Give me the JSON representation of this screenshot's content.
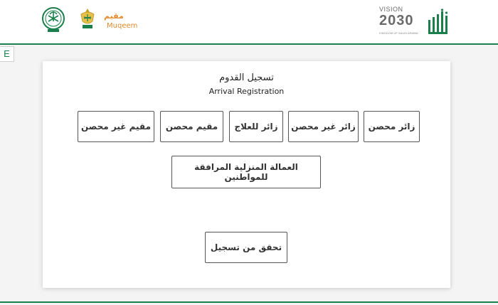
{
  "header": {
    "muqeem_ar": "مقيم",
    "muqeem_en": "Muqeem",
    "vision_word": "VISION",
    "vision_year": "2030",
    "vision_ksa": "KINGDOM OF SAUDI ARABIA",
    "brand_orange": "#e38b2c",
    "brand_green": "#1a7f4b"
  },
  "side_tab": {
    "label": "E"
  },
  "card": {
    "title_ar": "تسجيل القدوم",
    "title_en": "Arrival Registration",
    "options_row1": [
      "زائر محصن",
      "زائر غير محصن",
      "زائر للعلاج",
      "مقيم محصن",
      "مقيم غير محصن"
    ],
    "option_domestic": "العمالة المنزلية المرافقة للمواطنين",
    "verify_button": "تحقق من تسجيل"
  }
}
